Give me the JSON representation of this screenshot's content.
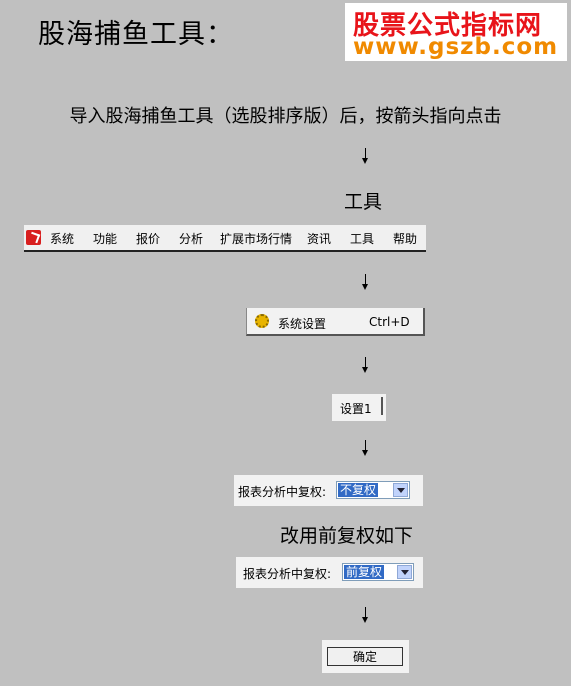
{
  "title": "股海捕鱼工具：",
  "logo": {
    "line1": "股票公式指标网",
    "line2": "www.gszb.com"
  },
  "intro": "导入股海捕鱼工具（选股排序版）后，按箭头指向点击",
  "step_tools_label": "工具",
  "menubar": {
    "items": [
      "系统",
      "功能",
      "报价",
      "分析",
      "扩展市场行情",
      "资讯",
      "工具",
      "帮助"
    ]
  },
  "menu_popup": {
    "label": "系统设置",
    "shortcut": "Ctrl+D",
    "icon": "gear-icon"
  },
  "tab": {
    "label": "设置1"
  },
  "field_before": {
    "label": "报表分析中复权:",
    "value": "不复权"
  },
  "change_text": "改用前复权如下",
  "field_after": {
    "label": "报表分析中复权:",
    "value": "前复权"
  },
  "confirm_button": "确定",
  "colors": {
    "background": "#c0c0c0",
    "logo_red": "#e8141a",
    "logo_orange": "#f08a00",
    "select_highlight": "#316ac5"
  }
}
